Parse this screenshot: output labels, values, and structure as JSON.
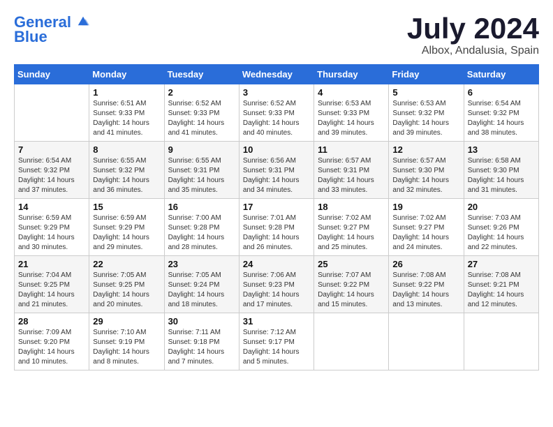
{
  "logo": {
    "line1": "General",
    "line2": "Blue"
  },
  "title": "July 2024",
  "location": "Albox, Andalusia, Spain",
  "days_of_week": [
    "Sunday",
    "Monday",
    "Tuesday",
    "Wednesday",
    "Thursday",
    "Friday",
    "Saturday"
  ],
  "weeks": [
    [
      {
        "day": "",
        "sunrise": "",
        "sunset": "",
        "daylight": ""
      },
      {
        "day": "1",
        "sunrise": "Sunrise: 6:51 AM",
        "sunset": "Sunset: 9:33 PM",
        "daylight": "Daylight: 14 hours and 41 minutes."
      },
      {
        "day": "2",
        "sunrise": "Sunrise: 6:52 AM",
        "sunset": "Sunset: 9:33 PM",
        "daylight": "Daylight: 14 hours and 41 minutes."
      },
      {
        "day": "3",
        "sunrise": "Sunrise: 6:52 AM",
        "sunset": "Sunset: 9:33 PM",
        "daylight": "Daylight: 14 hours and 40 minutes."
      },
      {
        "day": "4",
        "sunrise": "Sunrise: 6:53 AM",
        "sunset": "Sunset: 9:33 PM",
        "daylight": "Daylight: 14 hours and 39 minutes."
      },
      {
        "day": "5",
        "sunrise": "Sunrise: 6:53 AM",
        "sunset": "Sunset: 9:32 PM",
        "daylight": "Daylight: 14 hours and 39 minutes."
      },
      {
        "day": "6",
        "sunrise": "Sunrise: 6:54 AM",
        "sunset": "Sunset: 9:32 PM",
        "daylight": "Daylight: 14 hours and 38 minutes."
      }
    ],
    [
      {
        "day": "7",
        "sunrise": "Sunrise: 6:54 AM",
        "sunset": "Sunset: 9:32 PM",
        "daylight": "Daylight: 14 hours and 37 minutes."
      },
      {
        "day": "8",
        "sunrise": "Sunrise: 6:55 AM",
        "sunset": "Sunset: 9:32 PM",
        "daylight": "Daylight: 14 hours and 36 minutes."
      },
      {
        "day": "9",
        "sunrise": "Sunrise: 6:55 AM",
        "sunset": "Sunset: 9:31 PM",
        "daylight": "Daylight: 14 hours and 35 minutes."
      },
      {
        "day": "10",
        "sunrise": "Sunrise: 6:56 AM",
        "sunset": "Sunset: 9:31 PM",
        "daylight": "Daylight: 14 hours and 34 minutes."
      },
      {
        "day": "11",
        "sunrise": "Sunrise: 6:57 AM",
        "sunset": "Sunset: 9:31 PM",
        "daylight": "Daylight: 14 hours and 33 minutes."
      },
      {
        "day": "12",
        "sunrise": "Sunrise: 6:57 AM",
        "sunset": "Sunset: 9:30 PM",
        "daylight": "Daylight: 14 hours and 32 minutes."
      },
      {
        "day": "13",
        "sunrise": "Sunrise: 6:58 AM",
        "sunset": "Sunset: 9:30 PM",
        "daylight": "Daylight: 14 hours and 31 minutes."
      }
    ],
    [
      {
        "day": "14",
        "sunrise": "Sunrise: 6:59 AM",
        "sunset": "Sunset: 9:29 PM",
        "daylight": "Daylight: 14 hours and 30 minutes."
      },
      {
        "day": "15",
        "sunrise": "Sunrise: 6:59 AM",
        "sunset": "Sunset: 9:29 PM",
        "daylight": "Daylight: 14 hours and 29 minutes."
      },
      {
        "day": "16",
        "sunrise": "Sunrise: 7:00 AM",
        "sunset": "Sunset: 9:28 PM",
        "daylight": "Daylight: 14 hours and 28 minutes."
      },
      {
        "day": "17",
        "sunrise": "Sunrise: 7:01 AM",
        "sunset": "Sunset: 9:28 PM",
        "daylight": "Daylight: 14 hours and 26 minutes."
      },
      {
        "day": "18",
        "sunrise": "Sunrise: 7:02 AM",
        "sunset": "Sunset: 9:27 PM",
        "daylight": "Daylight: 14 hours and 25 minutes."
      },
      {
        "day": "19",
        "sunrise": "Sunrise: 7:02 AM",
        "sunset": "Sunset: 9:27 PM",
        "daylight": "Daylight: 14 hours and 24 minutes."
      },
      {
        "day": "20",
        "sunrise": "Sunrise: 7:03 AM",
        "sunset": "Sunset: 9:26 PM",
        "daylight": "Daylight: 14 hours and 22 minutes."
      }
    ],
    [
      {
        "day": "21",
        "sunrise": "Sunrise: 7:04 AM",
        "sunset": "Sunset: 9:25 PM",
        "daylight": "Daylight: 14 hours and 21 minutes."
      },
      {
        "day": "22",
        "sunrise": "Sunrise: 7:05 AM",
        "sunset": "Sunset: 9:25 PM",
        "daylight": "Daylight: 14 hours and 20 minutes."
      },
      {
        "day": "23",
        "sunrise": "Sunrise: 7:05 AM",
        "sunset": "Sunset: 9:24 PM",
        "daylight": "Daylight: 14 hours and 18 minutes."
      },
      {
        "day": "24",
        "sunrise": "Sunrise: 7:06 AM",
        "sunset": "Sunset: 9:23 PM",
        "daylight": "Daylight: 14 hours and 17 minutes."
      },
      {
        "day": "25",
        "sunrise": "Sunrise: 7:07 AM",
        "sunset": "Sunset: 9:22 PM",
        "daylight": "Daylight: 14 hours and 15 minutes."
      },
      {
        "day": "26",
        "sunrise": "Sunrise: 7:08 AM",
        "sunset": "Sunset: 9:22 PM",
        "daylight": "Daylight: 14 hours and 13 minutes."
      },
      {
        "day": "27",
        "sunrise": "Sunrise: 7:08 AM",
        "sunset": "Sunset: 9:21 PM",
        "daylight": "Daylight: 14 hours and 12 minutes."
      }
    ],
    [
      {
        "day": "28",
        "sunrise": "Sunrise: 7:09 AM",
        "sunset": "Sunset: 9:20 PM",
        "daylight": "Daylight: 14 hours and 10 minutes."
      },
      {
        "day": "29",
        "sunrise": "Sunrise: 7:10 AM",
        "sunset": "Sunset: 9:19 PM",
        "daylight": "Daylight: 14 hours and 8 minutes."
      },
      {
        "day": "30",
        "sunrise": "Sunrise: 7:11 AM",
        "sunset": "Sunset: 9:18 PM",
        "daylight": "Daylight: 14 hours and 7 minutes."
      },
      {
        "day": "31",
        "sunrise": "Sunrise: 7:12 AM",
        "sunset": "Sunset: 9:17 PM",
        "daylight": "Daylight: 14 hours and 5 minutes."
      },
      {
        "day": "",
        "sunrise": "",
        "sunset": "",
        "daylight": ""
      },
      {
        "day": "",
        "sunrise": "",
        "sunset": "",
        "daylight": ""
      },
      {
        "day": "",
        "sunrise": "",
        "sunset": "",
        "daylight": ""
      }
    ]
  ]
}
